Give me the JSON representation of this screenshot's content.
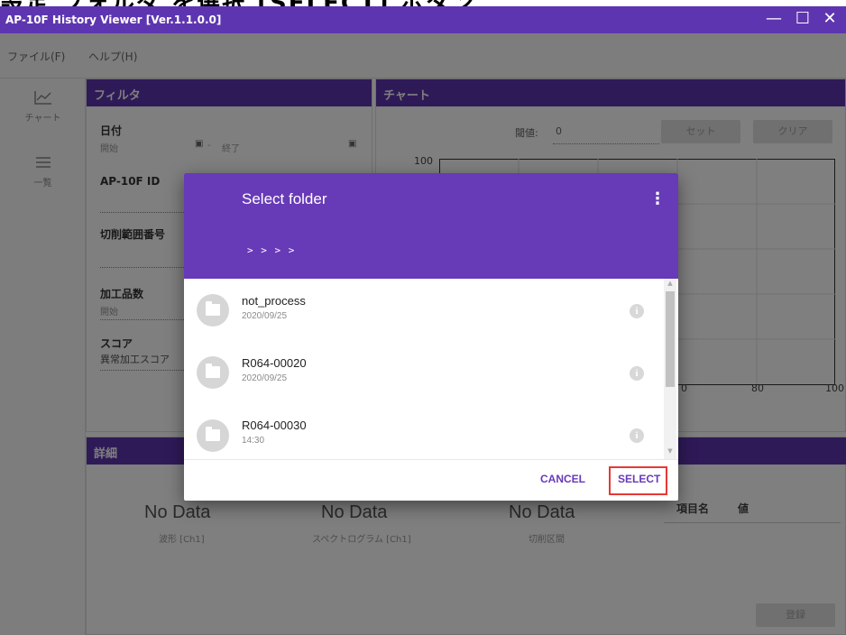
{
  "window": {
    "title": "AP-10F History Viewer [Ver.1.1.0.0]",
    "min_icon": "minimize-icon",
    "max_icon": "maximize-icon",
    "close_icon": "close-icon"
  },
  "menu": {
    "file": "ファイル(F)",
    "help": "ヘルプ(H)"
  },
  "sidebar": {
    "items": [
      {
        "label": "チャート",
        "icon": "line-chart-icon"
      },
      {
        "label": "一覧",
        "icon": "list-icon"
      }
    ]
  },
  "filter": {
    "header": "フィルタ",
    "date_label": "日付",
    "date_start_placeholder": "開始",
    "date_sep": "-",
    "date_end_placeholder": "終了",
    "ap_id_label": "AP-10F ID",
    "cut_range_label": "切削範囲番号",
    "work_count_label": "加工品数",
    "work_count_start": "開始",
    "score_label": "スコア",
    "score_sub": "異常加工スコア"
  },
  "chart": {
    "header": "チャート",
    "threshold_label": "閾値:",
    "threshold_value": "0",
    "set_button": "セット",
    "clear_button": "クリア",
    "y_top_tick": "100",
    "x_ticks": [
      "0",
      "80",
      "100"
    ]
  },
  "details": {
    "header": "詳細",
    "cards": [
      {
        "title": "No Data",
        "caption": "波形 [Ch1]"
      },
      {
        "title": "No Data",
        "caption": "スペクトログラム [Ch1]"
      },
      {
        "title": "No Data",
        "caption": "切削区間"
      }
    ],
    "table_col_name": "項目名",
    "table_col_value": "値",
    "register_button": "登録"
  },
  "dialog": {
    "title": "Select folder",
    "menu_icon": "more-vert-icon",
    "path": ">  >  >  >",
    "items": [
      {
        "name": "not_process",
        "date": "2020/09/25"
      },
      {
        "name": "R064-00020",
        "date": "2020/09/25"
      },
      {
        "name": "R064-00030",
        "date": "14:30"
      }
    ],
    "cancel_label": "CANCEL",
    "select_label": "SELECT"
  },
  "colors": {
    "primary": "#5e35b1",
    "dialog_header": "#673ab7",
    "highlight": "#e53935"
  }
}
